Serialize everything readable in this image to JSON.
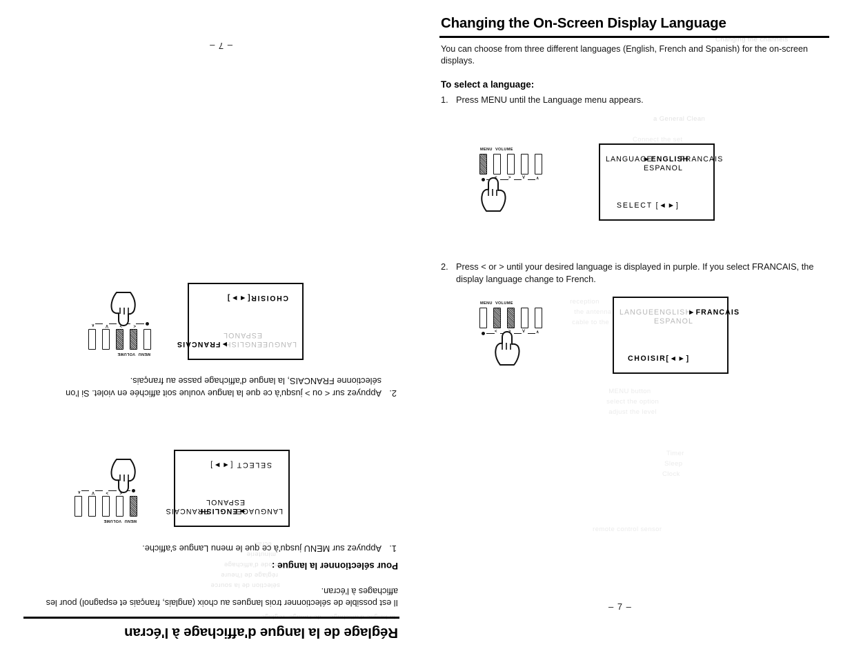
{
  "document": {
    "type": "scanned-manual-spread",
    "left_page": {
      "language": "French",
      "orientation": "rotated-180",
      "page_number": "– 7 –",
      "section_title": "Réglage de la langue d'affichage à l'écran",
      "intro": "Il est possible de sélectionner trois langues au choix (anglais, français et espagnol) pour les affichages à l'écran.",
      "sub_title": "Pour sélectionner la langue :",
      "steps": [
        {
          "number": "1.",
          "text": "Appuyez sur MENU jusqu'à ce que le menu Langue s'affiche."
        },
        {
          "number": "2.",
          "text": "Appuyez sur < ou > jusqu'à ce que la langue voulue soit affichée en violet. Si l'on sélectionne FRANCAIS, la langue d'affichage passe au français."
        }
      ],
      "figures": [
        {
          "name": "osd-language-menu-english",
          "lines": [
            {
              "text": "LANGUAGE:",
              "style": "normal"
            },
            {
              "text": "►ENGLISH",
              "style": "strong"
            },
            {
              "text": "FRANCAIS",
              "style": "normal"
            },
            {
              "text": "ESPANOL",
              "style": "normal"
            },
            {
              "text": "SELECT [◄►]",
              "style": "normal"
            }
          ],
          "panel": {
            "labels": [
              "MENU",
              "VOLUME"
            ],
            "markers": [
              "●",
              "<",
              ">",
              "V",
              "∧"
            ],
            "pressed": [
              "MENU"
            ]
          }
        },
        {
          "name": "osd-language-menu-francais",
          "lines": [
            {
              "text": "LANGUE:",
              "style": "faded"
            },
            {
              "text": "ENGLISH",
              "style": "faded"
            },
            {
              "text": "►FRANCAIS",
              "style": "strong"
            },
            {
              "text": "ESPANOL",
              "style": "faded"
            },
            {
              "text": "CHOISIR[◄►]",
              "style": "normal"
            }
          ],
          "panel": {
            "labels": [
              "MENU",
              "VOLUME"
            ],
            "markers": [
              "●",
              "<",
              ">",
              "V",
              "∧"
            ],
            "pressed": [
              "VOLUME-left",
              "VOLUME-right"
            ]
          }
        }
      ]
    },
    "right_page": {
      "language": "English",
      "orientation": "upright",
      "page_number": "– 7 –",
      "section_title": "Changing the On-Screen Display Language",
      "intro": "You can choose from three different languages (English, French and Spanish) for the on-screen displays.",
      "sub_title": "To select a language:",
      "steps": [
        {
          "number": "1.",
          "text": "Press MENU until the Language menu appears."
        },
        {
          "number": "2.",
          "text": "Press < or > until your desired language is displayed in purple. If you select FRANCAIS, the display language change to French."
        }
      ],
      "figures": [
        {
          "name": "osd-language-menu-english",
          "lines": [
            {
              "text": "LANGUAGE:",
              "style": "normal"
            },
            {
              "text": "►ENGLISH",
              "style": "strong"
            },
            {
              "text": "FRANCAIS",
              "style": "normal"
            },
            {
              "text": "ESPANOL",
              "style": "normal"
            },
            {
              "text": "SELECT [◄►]",
              "style": "normal"
            }
          ],
          "panel": {
            "labels": [
              "MENU",
              "VOLUME"
            ],
            "markers": [
              "●",
              "<",
              ">",
              "V",
              "∧"
            ],
            "pressed": [
              "MENU"
            ]
          }
        },
        {
          "name": "osd-language-menu-francais",
          "lines": [
            {
              "text": "LANGUE:",
              "style": "faded"
            },
            {
              "text": "ENGLISH",
              "style": "faded"
            },
            {
              "text": "►FRANCAIS",
              "style": "strong"
            },
            {
              "text": "ESPANOL",
              "style": "faded"
            },
            {
              "text": "CHOISIR[◄►]",
              "style": "normal"
            }
          ],
          "panel": {
            "labels": [
              "MENU",
              "VOLUME"
            ],
            "markers": [
              "●",
              "<",
              ">",
              "V",
              "∧"
            ],
            "pressed": [
              "VOLUME-left",
              "VOLUME-right"
            ]
          }
        }
      ]
    }
  },
  "colors": {
    "ink": "#111111",
    "faded_ink": "#b9b9b9",
    "ghost": "#dedede",
    "paper": "#ffffff"
  }
}
